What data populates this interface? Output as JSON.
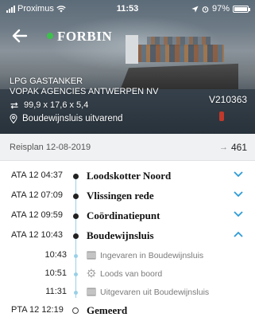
{
  "status_bar": {
    "carrier": "Proximus",
    "time": "11:53",
    "battery": "97%",
    "battery_level": 0.97
  },
  "header": {
    "vessel_name": "FORBIN",
    "status_color": "#3cc24a",
    "vessel_type": "LPG GASTANKER",
    "agent": "VOPAK AGENCIES ANTWERPEN NV",
    "dimensions": "99,9 x 17,6 x 5,4",
    "location": "Boudewijnsluis uitvarend",
    "code": "V210363"
  },
  "reisplan": {
    "label": "Reisplan 12-08-2019",
    "count": "461"
  },
  "timeline": {
    "accent_color": "#2e9bd6",
    "items": [
      {
        "time": "ATA 12 04:37",
        "name": "Loodskotter Noord",
        "expand": "chevron-down"
      },
      {
        "time": "ATA 12 07:09",
        "name": "Vlissingen rede",
        "expand": "chevron-down"
      },
      {
        "time": "ATA 12 09:59",
        "name": "Coördinatiepunt",
        "expand": "chevron-down"
      },
      {
        "time": "ATA 12 10:43",
        "name": "Boudewijnsluis",
        "expand": "chevron-up"
      }
    ],
    "events": [
      {
        "time": "10:43",
        "icon": "lock-gate-icon",
        "text": "Ingevaren in Boudewijnsluis"
      },
      {
        "time": "10:51",
        "icon": "pilot-wheel-icon",
        "text": "Loods van boord"
      },
      {
        "time": "11:31",
        "icon": "lock-gate-icon",
        "text": "Uitgevaren uit Boudewijnsluis"
      }
    ],
    "planned": {
      "time": "PTA 12 12:19",
      "name": "Gemeerd"
    }
  }
}
